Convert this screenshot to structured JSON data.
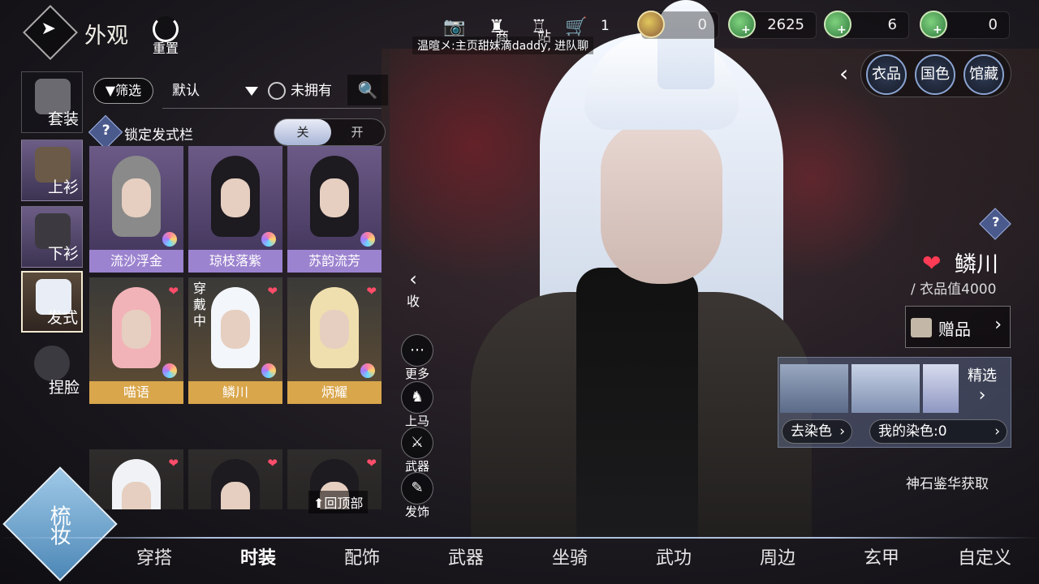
{
  "header": {
    "title": "外观",
    "reset_label": "重置",
    "cart_count": "1",
    "notice": "温暄メ:主页甜妹滴daddy, 进队聊",
    "top_icon_labels": [
      "商",
      "站"
    ]
  },
  "currencies": [
    {
      "icon": "gem-coin-icon",
      "value": "0",
      "color": "#e2c85d"
    },
    {
      "icon": "jade-coin-icon",
      "value": "2625",
      "color": "#5fbf6a"
    },
    {
      "icon": "jade-coin-icon",
      "value": "6",
      "color": "#5fbf6a"
    },
    {
      "icon": "jade-coin-icon",
      "value": "0",
      "color": "#5fbf6a"
    }
  ],
  "categories": [
    {
      "label": "套装",
      "icon": "outfit-icon"
    },
    {
      "label": "上衫",
      "icon": "jacket-icon"
    },
    {
      "label": "下衫",
      "icon": "pants-icon"
    },
    {
      "label": "发式",
      "icon": "hairstyle-icon",
      "active": true
    },
    {
      "label": "捏脸",
      "icon": "face-icon"
    }
  ],
  "filter": {
    "filter_label": "筛选",
    "sort_value": "默认",
    "unowned_label": "未拥有"
  },
  "lock_row": {
    "label": "锁定发式栏",
    "off_label": "关",
    "on_label": "开"
  },
  "items": [
    {
      "name": "流沙浮金",
      "rarity": "purple",
      "hair_color": "#8a8a8a",
      "dye": true,
      "fav": false
    },
    {
      "name": "琼枝落紫",
      "rarity": "purple",
      "hair_color": "#1d1a20",
      "dye": true,
      "fav": false
    },
    {
      "name": "苏韵流芳",
      "rarity": "purple",
      "hair_color": "#1d1a20",
      "dye": true,
      "fav": false
    },
    {
      "name": "喵语",
      "rarity": "gold",
      "hair_color": "#f2b3b8",
      "dye": true,
      "fav": true
    },
    {
      "name": "鳞川",
      "rarity": "gold",
      "hair_color": "#f3f6fb",
      "dye": true,
      "fav": true,
      "selected": true,
      "wearing": "穿戴中"
    },
    {
      "name": "炳耀",
      "rarity": "gold",
      "hair_color": "#f0dfae",
      "dye": true,
      "fav": true
    }
  ],
  "back_to_top": "回顶部",
  "collapse_label": "收",
  "side_actions": [
    {
      "label": "更多",
      "icon": "more-icon"
    },
    {
      "label": "上马",
      "icon": "horse-icon"
    },
    {
      "label": "武器",
      "icon": "weapon-icon"
    },
    {
      "label": "发饰",
      "icon": "hair-ornament-icon"
    }
  ],
  "right_tabs": [
    "衣品",
    "国色",
    "馆藏"
  ],
  "character": {
    "name": "鳞川",
    "outfit_value": "/ 衣品值4000"
  },
  "gift_label": "赠品",
  "dye": {
    "featured_label": "精选",
    "remove_dye_label": "去染色",
    "my_dye_label": "我的染色:0"
  },
  "acquire_label": "神石鉴华获取",
  "comb_label": "梳妆",
  "bottom_nav": [
    "穿搭",
    "时装",
    "配饰",
    "武器",
    "坐骑",
    "武功",
    "周边",
    "玄甲",
    "自定义"
  ],
  "bottom_nav_active": "时装"
}
